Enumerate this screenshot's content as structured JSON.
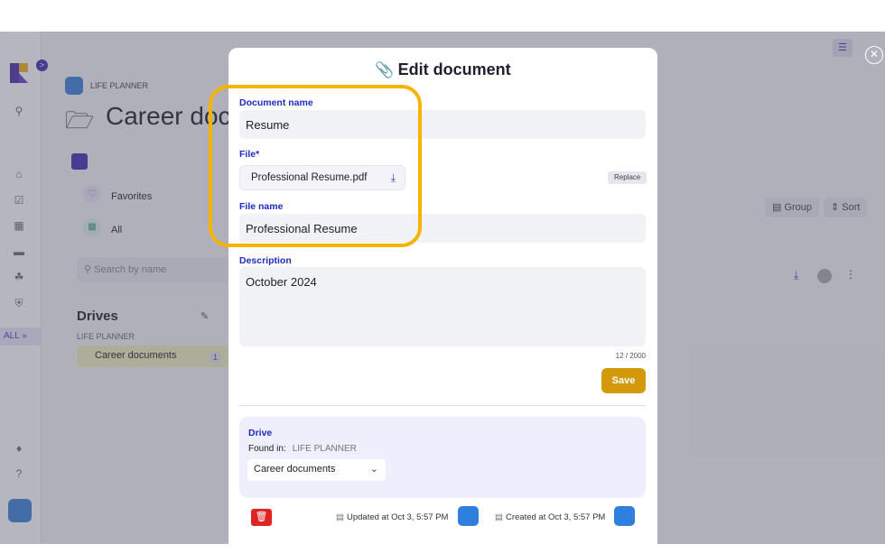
{
  "app": {
    "expand_icon": ">",
    "all_toggle": "ALL »",
    "breadcrumb": "LIFE PLANNER",
    "page_title": "Career doc",
    "favorites": "Favorites",
    "all": "All",
    "search_placeholder": "Search by name",
    "drives_title": "Drives",
    "drives_section": "LIFE PLANNER",
    "drive_item": "Career documents",
    "drive_item_count": "1",
    "group_btn": "Group",
    "sort_btn": "Sort"
  },
  "modal": {
    "title": "Edit document",
    "doc_name_label": "Document name",
    "doc_name_value": "Resume",
    "file_label": "File*",
    "file_value": "Professional Resume.pdf",
    "replace": "Replace",
    "file_name_label": "File name",
    "file_name_value": "Professional Resume",
    "description_label": "Description",
    "description_value": "October 2024",
    "counter": "12 / 2000",
    "save": "Save",
    "drive_label": "Drive",
    "found_in": "Found in:",
    "found_in_tag": "LIFE PLANNER",
    "drive_select": "Career documents",
    "updated": "Updated at Oct 3, 5:57 PM",
    "created": "Created at Oct 3, 5:57 PM"
  },
  "colors": {
    "accent": "#1d2bbf",
    "save": "#d29a0b",
    "highlight": "#f5b404",
    "danger": "#e02424"
  }
}
